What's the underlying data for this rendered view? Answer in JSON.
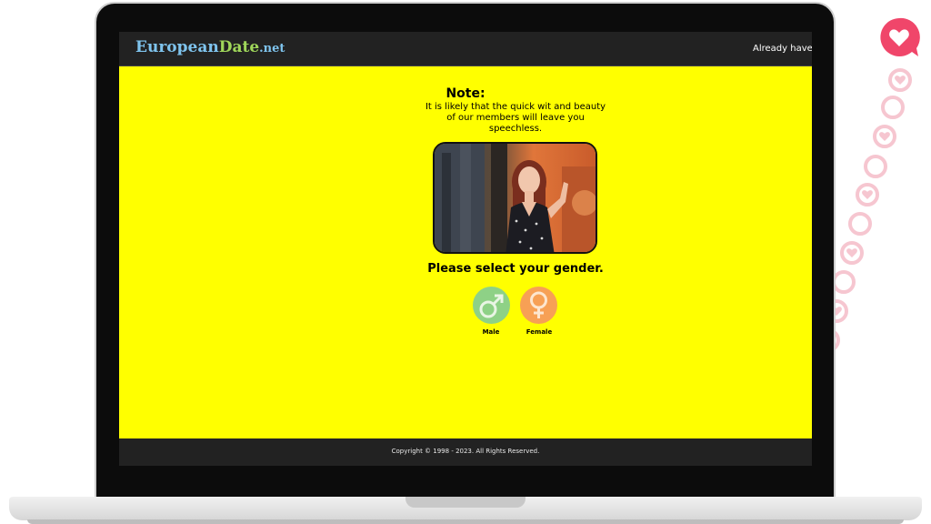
{
  "header": {
    "brand_part1": "European",
    "brand_part2": "Date",
    "brand_part3": ".net",
    "signin_text": "Already have a"
  },
  "main": {
    "note_title": "Note:",
    "note_text": "It is likely that the quick wit and beauty of our members will leave you speechless.",
    "gender_prompt": "Please select your gender.",
    "genders": [
      {
        "label": "Male",
        "icon": "male-symbol-icon",
        "color": "#8ed186"
      },
      {
        "label": "Female",
        "icon": "female-symbol-icon",
        "color": "#f7a055"
      }
    ]
  },
  "footer": {
    "copyright": "Copyright © 1998 - 2023. All Rights Reserved."
  },
  "colors": {
    "page_background": "#ffff00",
    "header_background": "#222222",
    "accent_pink": "#f0466a"
  }
}
